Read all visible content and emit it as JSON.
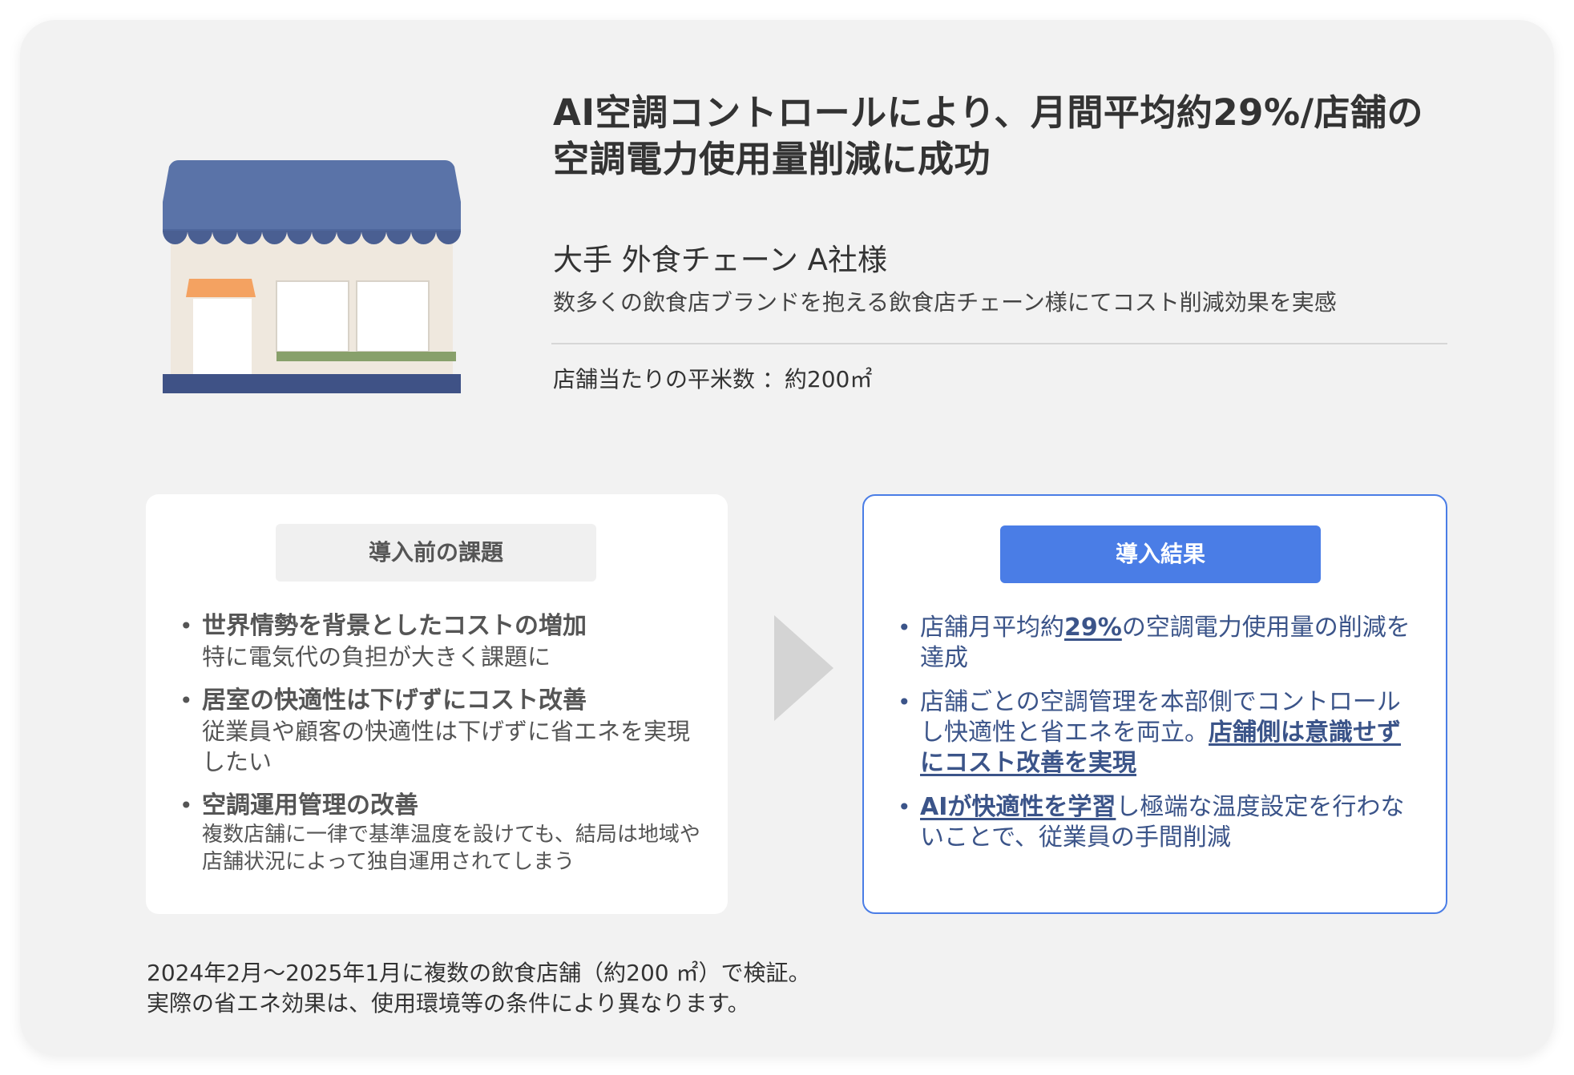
{
  "title_lines": [
    "AI空調コントロールにより、月間平均約29%/店舗の",
    "空調電力使用量削減に成功"
  ],
  "client": "大手 外食チェーン A社様",
  "description": "数多くの飲食店ブランドを抱える飲食店チェーン様にてコスト削減効果を実感",
  "area": "店舗当たりの平米数 ：約200㎡",
  "before": {
    "label": "導入前の課題",
    "items": [
      {
        "head": "世界情勢を背景としたコストの増加",
        "sub": "特に電気代の負担が大きく課題に"
      },
      {
        "head": "居室の快適性は下げずにコスト改善",
        "sub": "従業員や顧客の快適性は下げずに省エネを実現したい"
      },
      {
        "head": "空調運用管理の改善",
        "sub": "複数店舗に一律で基準温度を設けても、結局は地域や店舗状況によって独自運用されてしまう"
      }
    ]
  },
  "after": {
    "label": "導入結果",
    "items": [
      {
        "pre": "店舗月平均約",
        "hl": "29%",
        "post": "の空調電力使用量の削減を達成"
      },
      {
        "pre": "店舗ごとの空調管理を本部側でコントロールし快適性と省エネを両立。",
        "hl": "店舗側は意識せずにコスト改善を実現",
        "post": ""
      },
      {
        "pre": "",
        "hl": "AIが快適性を学習",
        "post": "し極端な温度設定を行わないことで、従業員の手間削減"
      }
    ]
  },
  "note_lines": [
    "2024年2月～2025年1月に複数の飲食店舗（約200 ㎡）で検証。",
    "実際の省エネ効果は、使用環境等の条件により異なります。"
  ],
  "icons": {
    "illustration": "store-icon",
    "arrow": "chevron-right-icon"
  },
  "colors": {
    "accent": "#4a7de6",
    "awning": "#5a73a8",
    "result_text": "#3b5489",
    "background": "#f2f2f2"
  }
}
